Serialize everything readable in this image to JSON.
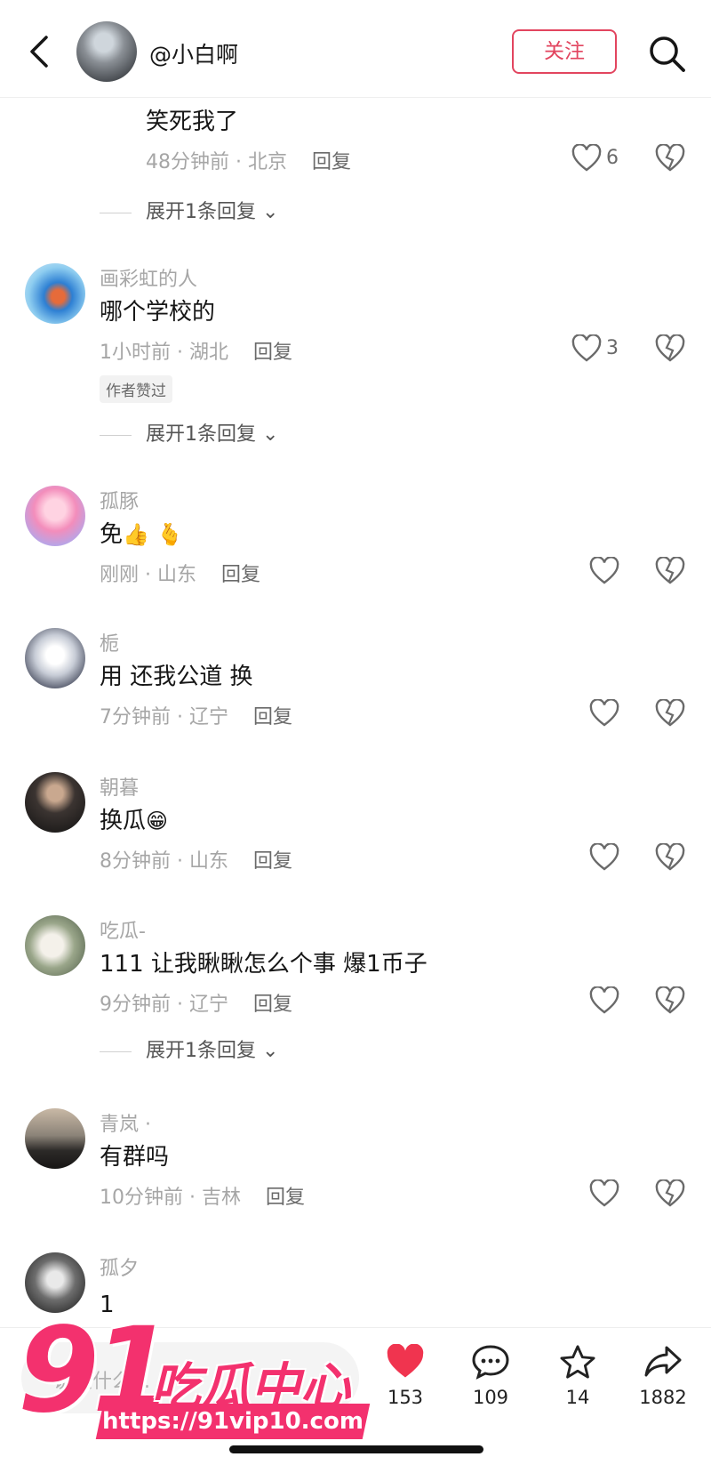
{
  "header": {
    "back_icon": "chevron-left-icon",
    "username": "@小白啊",
    "follow_label": "关注",
    "search_icon": "search-icon"
  },
  "expand_label": "展开1条回复",
  "reply_label": "回复",
  "comments": [
    {
      "text": "笑死我了",
      "meta": "48分钟前 · 北京",
      "likes": "6",
      "has_expand": true
    },
    {
      "username": "画彩虹的人",
      "text": "哪个学校的",
      "meta": "1小时前 · 湖北",
      "likes": "3",
      "badge": "作者赞过",
      "has_expand": true
    },
    {
      "username": "孤豚",
      "text": "免",
      "emojis": [
        "thumbs-up-emoji",
        "finger-heart-emoji"
      ],
      "meta": "刚刚 · 山东",
      "likes": ""
    },
    {
      "username": "栀",
      "text": "用 还我公道 换",
      "meta": "7分钟前 · 辽宁",
      "likes": ""
    },
    {
      "username": "朝暮",
      "text": "换瓜",
      "emojis": [
        "grinning-face-emoji"
      ],
      "meta": "8分钟前 · 山东",
      "likes": ""
    },
    {
      "username": "吃瓜-",
      "text": "111 让我瞅瞅怎么个事 爆1币子",
      "meta": "9分钟前 · 辽宁",
      "likes": "",
      "has_expand": true
    },
    {
      "username": "青岚 ·",
      "text": "有群吗",
      "meta": "10分钟前 · 吉林",
      "likes": ""
    },
    {
      "username": "孤夕",
      "text": "1"
    }
  ],
  "bottom_bar": {
    "input_placeholder": "说点什么...",
    "like_count": "153",
    "comment_count": "109",
    "favorite_count": "14",
    "share_count": "1882"
  },
  "watermark": {
    "logo_number": "91",
    "logo_text": "吃瓜中心",
    "url": "https://91vip10.com",
    "brand_color": "#f3316e"
  },
  "colors": {
    "accent": "#e2455f",
    "muted_text": "#a6a6a6",
    "like_red": "#f0344f"
  }
}
